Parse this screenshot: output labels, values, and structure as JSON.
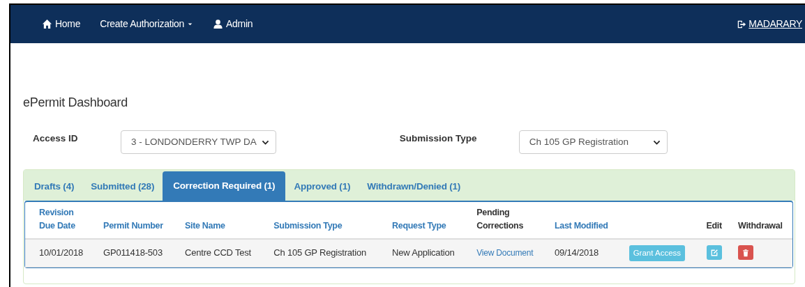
{
  "navbar": {
    "items": [
      {
        "label": "Home"
      },
      {
        "label": "Create Authorization"
      },
      {
        "label": "Admin"
      }
    ],
    "user": {
      "label": "MADARARY"
    }
  },
  "title": "ePermit Dashboard",
  "filters": [
    {
      "label": "Access ID",
      "value": "3 - LONDONDERRY TWP DA"
    },
    {
      "label": "Submission Type",
      "value": "Ch 105 GP Registration"
    }
  ],
  "tabs": [
    {
      "label": "Drafts (4)",
      "selected": false
    },
    {
      "label": "Submitted (28)",
      "selected": false
    },
    {
      "label": "Correction Required (1)",
      "selected": true
    },
    {
      "label": "Approved (1)",
      "selected": false
    },
    {
      "label": "Withdrawn/Denied (1)",
      "selected": false
    }
  ],
  "table": {
    "columns": [
      {
        "label": "Revision Due Date",
        "sortable": true
      },
      {
        "label": "Permit Number",
        "sortable": true
      },
      {
        "label": "Site Name",
        "sortable": true
      },
      {
        "label": "Submission Type",
        "sortable": true
      },
      {
        "label": "Request Type",
        "sortable": true
      },
      {
        "label": "Pending Corrections",
        "sortable": false
      },
      {
        "label": "Last Modified",
        "sortable": true
      },
      {
        "label": "Edit",
        "sortable": false
      },
      {
        "label": "Withdrawal",
        "sortable": false
      }
    ],
    "rows": [
      {
        "cells": [
          {
            "kind": "text",
            "text": "10/01/2018"
          },
          {
            "kind": "text",
            "text": "GP011418-503"
          },
          {
            "kind": "text",
            "text": "Centre CCD Test"
          },
          {
            "kind": "text",
            "text": "Ch 105 GP Registration"
          },
          {
            "kind": "text",
            "text": "New Application"
          },
          {
            "kind": "link",
            "text": "View Document"
          },
          {
            "kind": "text",
            "text": "09/14/2018"
          },
          {
            "kind": "button",
            "text": "Grant Access"
          },
          {
            "kind": "edit"
          },
          {
            "kind": "delete"
          }
        ]
      }
    ]
  }
}
